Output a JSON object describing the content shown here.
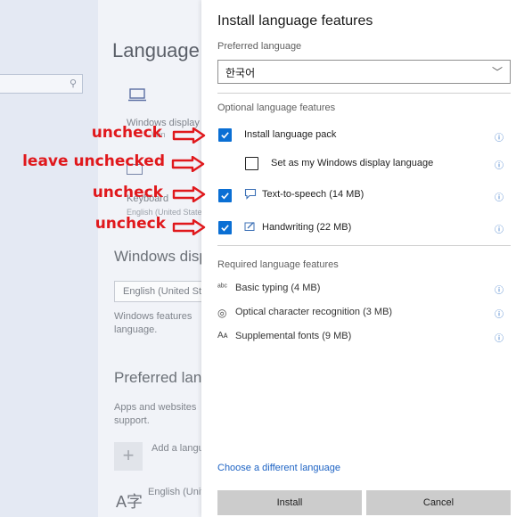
{
  "background_page": {
    "title": "Language",
    "windows_display_label": "Windows display",
    "display_sub": "Win",
    "keyboard_label": "Keyboard",
    "keyboard_sub": "English (United States)",
    "windows_display_heading": "Windows display language",
    "windows_display_value": "English (United States)",
    "windows_features_text_1": "Windows features",
    "windows_features_text_2": "language.",
    "preferred_heading": "Preferred languages",
    "apps_text_1": "Apps and websites",
    "apps_text_2": "support.",
    "add_language_label": "Add a language",
    "english_item_label": "English (United States)"
  },
  "dialog": {
    "title": "Install language features",
    "preferred_label": "Preferred language",
    "preferred_value": "한국어",
    "optional_heading": "Optional language features",
    "optional": [
      {
        "label": "Install language pack",
        "checked": true,
        "icon": ""
      },
      {
        "label": "Set as my Windows display language",
        "checked": false,
        "icon": ""
      },
      {
        "label": "Text-to-speech (14 MB)",
        "checked": true,
        "icon": "speech-icon"
      },
      {
        "label": "Handwriting (22 MB)",
        "checked": true,
        "icon": "pen-icon"
      }
    ],
    "required_heading": "Required language features",
    "required": [
      {
        "label": "Basic typing (4 MB)",
        "icon": "abc-icon",
        "glyph": "ᵃᵇᶜ"
      },
      {
        "label": "Optical character recognition (3 MB)",
        "icon": "ocr-icon",
        "glyph": "◎"
      },
      {
        "label": "Supplemental fonts (9 MB)",
        "icon": "font-icon",
        "glyph": "Aᴀ"
      }
    ],
    "link_label": "Choose a different language",
    "install_label": "Install",
    "cancel_label": "Cancel"
  },
  "annotations": [
    {
      "text": "uncheck"
    },
    {
      "text": "leave unchecked"
    },
    {
      "text": "uncheck"
    },
    {
      "text": "uncheck"
    }
  ],
  "colors": {
    "accent": "#0a6fd4",
    "annotation": "#e0181c"
  }
}
